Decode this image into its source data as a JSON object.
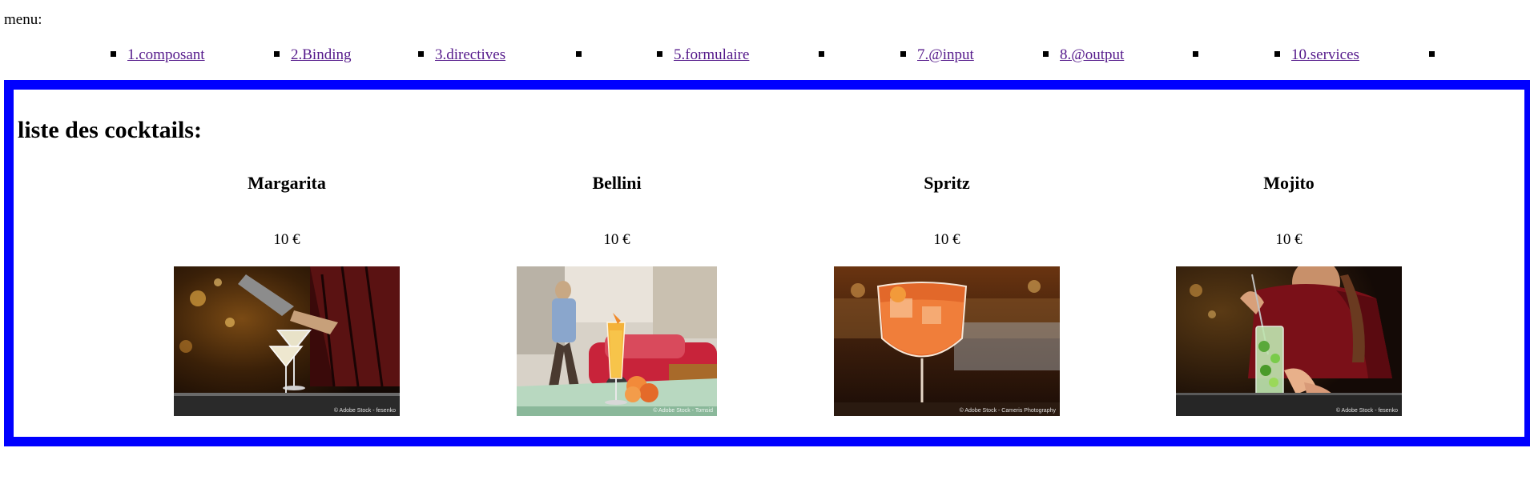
{
  "menu": {
    "label": "menu:",
    "items": [
      {
        "label": "1.composant"
      },
      {
        "label": "2.Binding"
      },
      {
        "label": "3.directives"
      },
      {
        "label": ""
      },
      {
        "label": "5.formulaire"
      },
      {
        "label": ""
      },
      {
        "label": "7.@input"
      },
      {
        "label": "8.@output"
      },
      {
        "label": ""
      },
      {
        "label": "10.services"
      },
      {
        "label": ""
      }
    ]
  },
  "colors": {
    "panel_border": "#0000ff",
    "link": "#551a8b"
  },
  "cocktails": {
    "title": "liste des cocktails:",
    "items": [
      {
        "name": "Margarita",
        "price": "10 €",
        "credit": "© Adobe Stock - fesenko"
      },
      {
        "name": "Bellini",
        "price": "10 €",
        "credit": "© Adobe Stock - Tomsid"
      },
      {
        "name": "Spritz",
        "price": "10 €",
        "credit": "© Adobe Stock - Cameris Photography"
      },
      {
        "name": "Mojito",
        "price": "10 €",
        "credit": "© Adobe Stock - fesenko"
      }
    ]
  }
}
